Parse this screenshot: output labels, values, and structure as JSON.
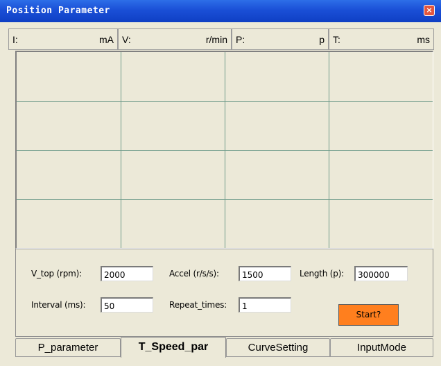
{
  "window": {
    "title": "Position Parameter",
    "close_glyph": "×"
  },
  "status": {
    "current_label": "I:",
    "current_unit": "mA",
    "velocity_label": "V:",
    "velocity_unit": "r/min",
    "position_label": "P:",
    "position_unit": "p",
    "time_label": "T:",
    "time_unit": "ms"
  },
  "plot": {
    "columns": 4,
    "rows": 4,
    "grid_color": "#6f9b8a"
  },
  "params": {
    "vtop_label": "V_top (rpm):",
    "vtop_value": "2000",
    "accel_label": "Accel (r/s/s):",
    "accel_value": "1500",
    "length_label": "Length (p):",
    "length_value": "300000",
    "interval_label": "Interval (ms):",
    "interval_value": "50",
    "repeat_label": "Repeat_times:",
    "repeat_value": "1",
    "start_label": "Start?"
  },
  "tabs": {
    "p_parameter": "P_parameter",
    "t_speed_par": "T_Speed_par",
    "curve_setting": "CurveSetting",
    "input_mode": "InputMode",
    "active": "T_Speed_par"
  },
  "colors": {
    "title_bar": "#1a4fd6",
    "window_face": "#ece9d8",
    "start_button": "#ff7f1e",
    "close_button": "#e2563f"
  }
}
